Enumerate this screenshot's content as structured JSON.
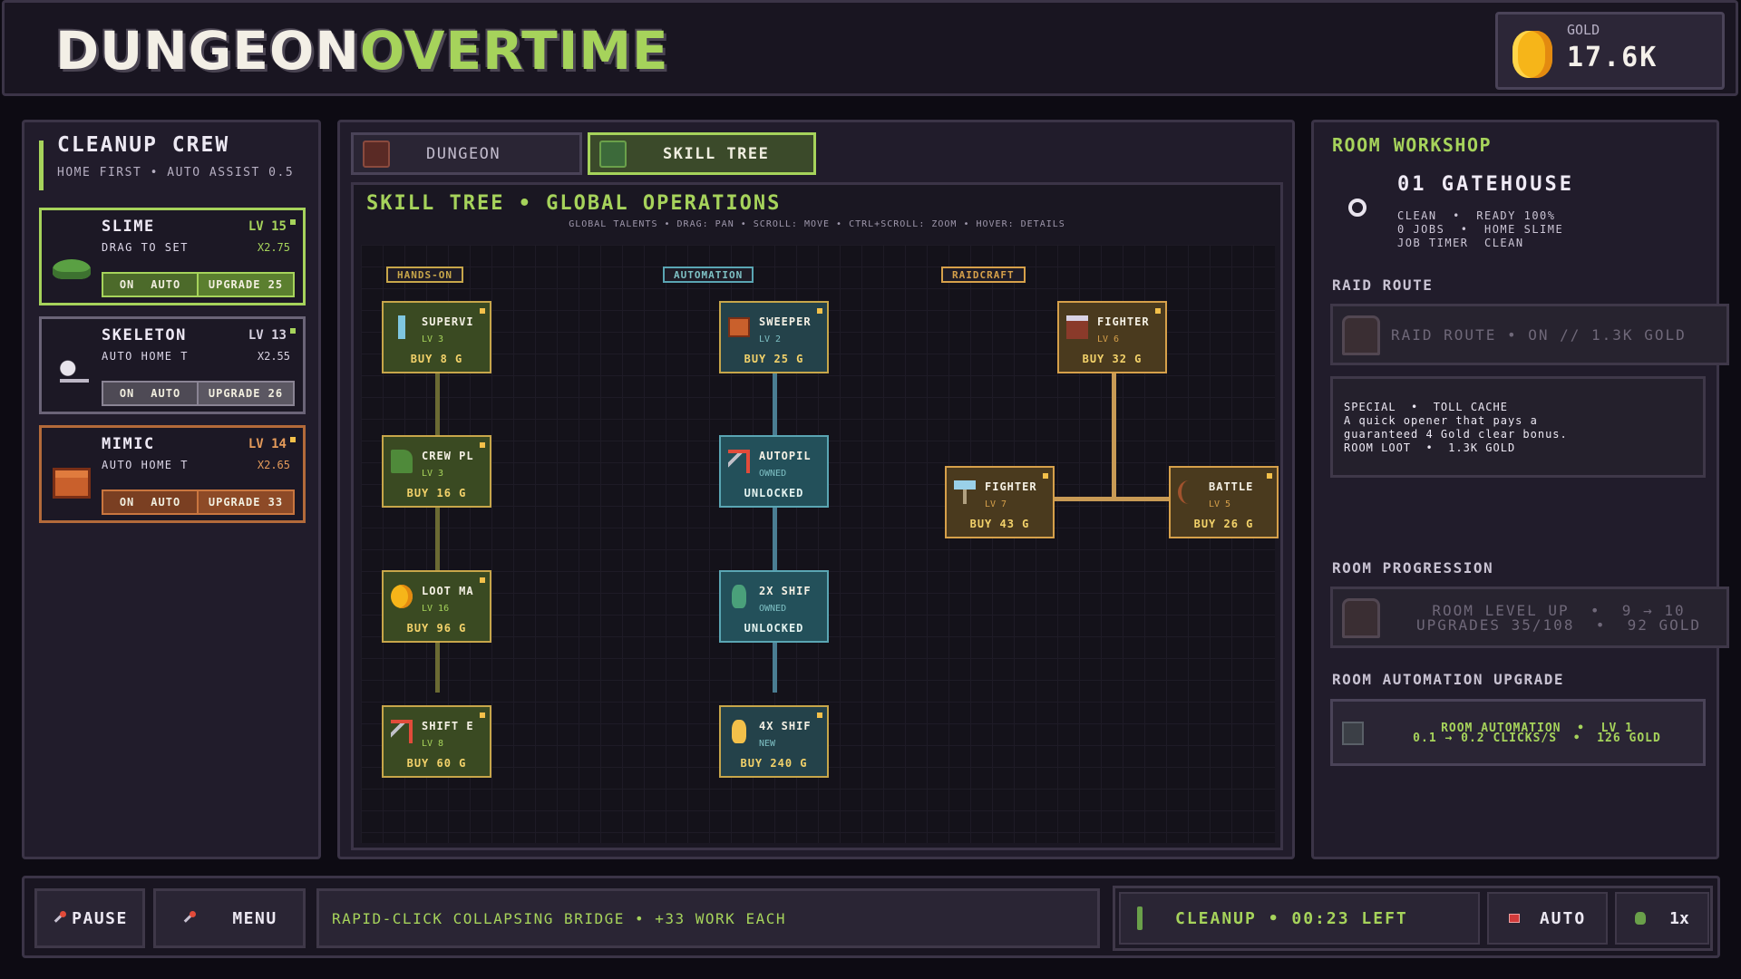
{
  "header": {
    "title_part1": "Dungeon",
    "title_part2": "Overtime",
    "gold_label": "GOLD",
    "gold_value": "17.6K"
  },
  "crew": {
    "title": "CLEANUP CREW",
    "subtitle": "HOME FIRST  •  AUTO ASSIST 0.5",
    "units": [
      {
        "name": "SLIME",
        "level": "LV 15",
        "desc": "DRAG TO SET",
        "mult": "x2.75",
        "on": "ON",
        "auto": "AUTO",
        "upgrade": "UPGRADE 25",
        "icon": "slime-icon"
      },
      {
        "name": "SKELETON",
        "level": "LV 13",
        "desc": "AUTO  HOME T",
        "mult": "x2.55",
        "on": "ON",
        "auto": "AUTO",
        "upgrade": "UPGRADE 26",
        "icon": "skeleton-icon"
      },
      {
        "name": "MIMIC",
        "level": "LV 14",
        "desc": "AUTO  HOME T",
        "mult": "x2.65",
        "on": "ON",
        "auto": "AUTO",
        "upgrade": "UPGRADE 33",
        "icon": "mimic-chest-icon"
      }
    ]
  },
  "tabs": [
    {
      "label": "DUNGEON",
      "icon": "door-icon"
    },
    {
      "label": "SKILL TREE",
      "icon": "chest-icon"
    }
  ],
  "skill_tree": {
    "title": "SKILL TREE  •  GLOBAL OPERATIONS",
    "hint": "GLOBAL TALENTS  •  DRAG: PAN  •  SCROLL: MOVE  •  CTRL+SCROLL: ZOOM  •  HOVER: DETAILS",
    "columns": [
      {
        "label": "HANDS-ON",
        "color": "#c7a64a"
      },
      {
        "label": "AUTOMATION",
        "color": "#5aa5b3"
      },
      {
        "label": "RAIDCRAFT",
        "color": "#d6a04a"
      }
    ],
    "nodes": [
      {
        "title": "SUPERVI",
        "sub": "LV 3",
        "buy": "BUY 8 G",
        "icon": "sword-icon"
      },
      {
        "title": "CREW PL",
        "sub": "LV 3",
        "buy": "BUY 16 G",
        "icon": "boot-icon"
      },
      {
        "title": "LOOT MA",
        "sub": "LV 16",
        "buy": "BUY 96 G",
        "icon": "gold-coin-icon"
      },
      {
        "title": "SHIFT E",
        "sub": "LV 8",
        "buy": "BUY 60 G",
        "icon": "lever-icon"
      },
      {
        "title": "SWEEPER",
        "sub": "LV 2",
        "buy": "BUY 25 G",
        "icon": "chest-icon"
      },
      {
        "title": "AUTOPIL",
        "sub": "OWNED",
        "buy": "UNLOCKED",
        "icon": "lever-icon"
      },
      {
        "title": "2X SHIF",
        "sub": "OWNED",
        "buy": "UNLOCKED",
        "icon": "potion-icon"
      },
      {
        "title": "4X SHIF",
        "sub": "NEW",
        "buy": "BUY 240 G",
        "icon": "potion-icon"
      },
      {
        "title": "FIGHTER",
        "sub": "LV 6",
        "buy": "BUY 32 G",
        "icon": "banner-icon"
      },
      {
        "title": "FIGHTER",
        "sub": "LV 7",
        "buy": "BUY 43 G",
        "icon": "axe-icon"
      },
      {
        "title": "BATTLE",
        "sub": "LV 5",
        "buy": "BUY 26 G",
        "icon": "bow-icon"
      }
    ]
  },
  "workshop": {
    "title": "ROOM WORKSHOP",
    "room_name": "01  GATEHOUSE",
    "room_info": "CLEAN  •  READY 100%\n0 JOBS  •  HOME SLIME\nJOB TIMER  CLEAN",
    "raid_head": "RAID ROUTE",
    "raid_text": "RAID ROUTE  •  ON  //  1.3K GOLD",
    "special_text": "SPECIAL  •  TOLL CACHE\nA quick opener that pays a\nguaranteed 4 Gold clear bonus.\nROOM LOOT  •  1.3K GOLD",
    "prog_head": "ROOM PROGRESSION",
    "prog_text": "ROOM LEVEL UP  •  9 → 10\nUPGRADES 35/108  •  92 GOLD",
    "auto_head": "ROOM AUTOMATION UPGRADE",
    "auto_text": "ROOM AUTOMATION  •  LV 1\n0.1 → 0.2 CLICKS/S  •  126 GOLD"
  },
  "footer": {
    "pause": "PAUSE",
    "menu": "MENU",
    "event": "RAPID-CLICK COLLAPSING BRIDGE  •  +33 WORK EACH",
    "status": "CLEANUP  •  00:23 LEFT",
    "auto": "AUTO",
    "speed": "1x"
  }
}
